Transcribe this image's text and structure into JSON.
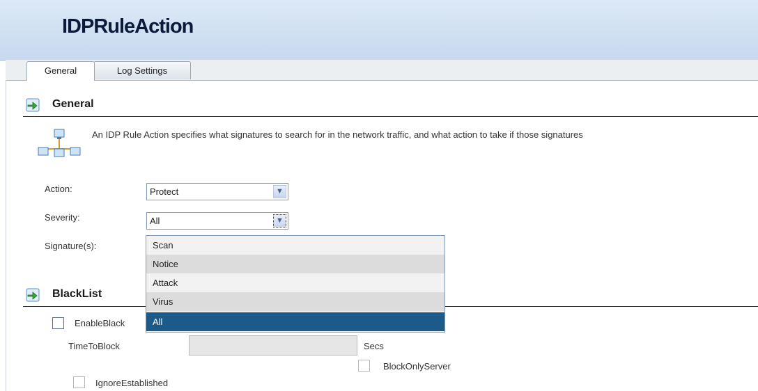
{
  "page_title": "IDPRuleAction",
  "tabs": [
    {
      "label": "General"
    },
    {
      "label": "Log Settings"
    }
  ],
  "general": {
    "title": "General",
    "description": "An IDP Rule Action specifies what signatures to search for in the network traffic, and what action to take if those signatures",
    "action": {
      "label": "Action:",
      "value": "Protect"
    },
    "severity": {
      "label": "Severity:",
      "value": "All"
    },
    "signatures": {
      "label": "Signature(s):"
    },
    "severity_options": [
      "Scan",
      "Notice",
      "Attack",
      "Virus",
      "All"
    ],
    "severity_selected": "All"
  },
  "blacklist": {
    "title": "BlackList",
    "enable_label": "EnableBlack",
    "time_to_block_label": "TimeToBlock",
    "time_to_block_value": "",
    "secs_label": "Secs",
    "block_only_server_label": "BlockOnlyServer",
    "ignore_established_label": "IgnoreEstablished"
  },
  "icons": {
    "section_icon": "green-arrow-section-icon",
    "info_icon": "network-computers-icon",
    "dropdown_arrow": "chevron-down-icon"
  },
  "colors": {
    "header_bg": "#c7d9ee",
    "selected_option": "#1c5a8a"
  }
}
